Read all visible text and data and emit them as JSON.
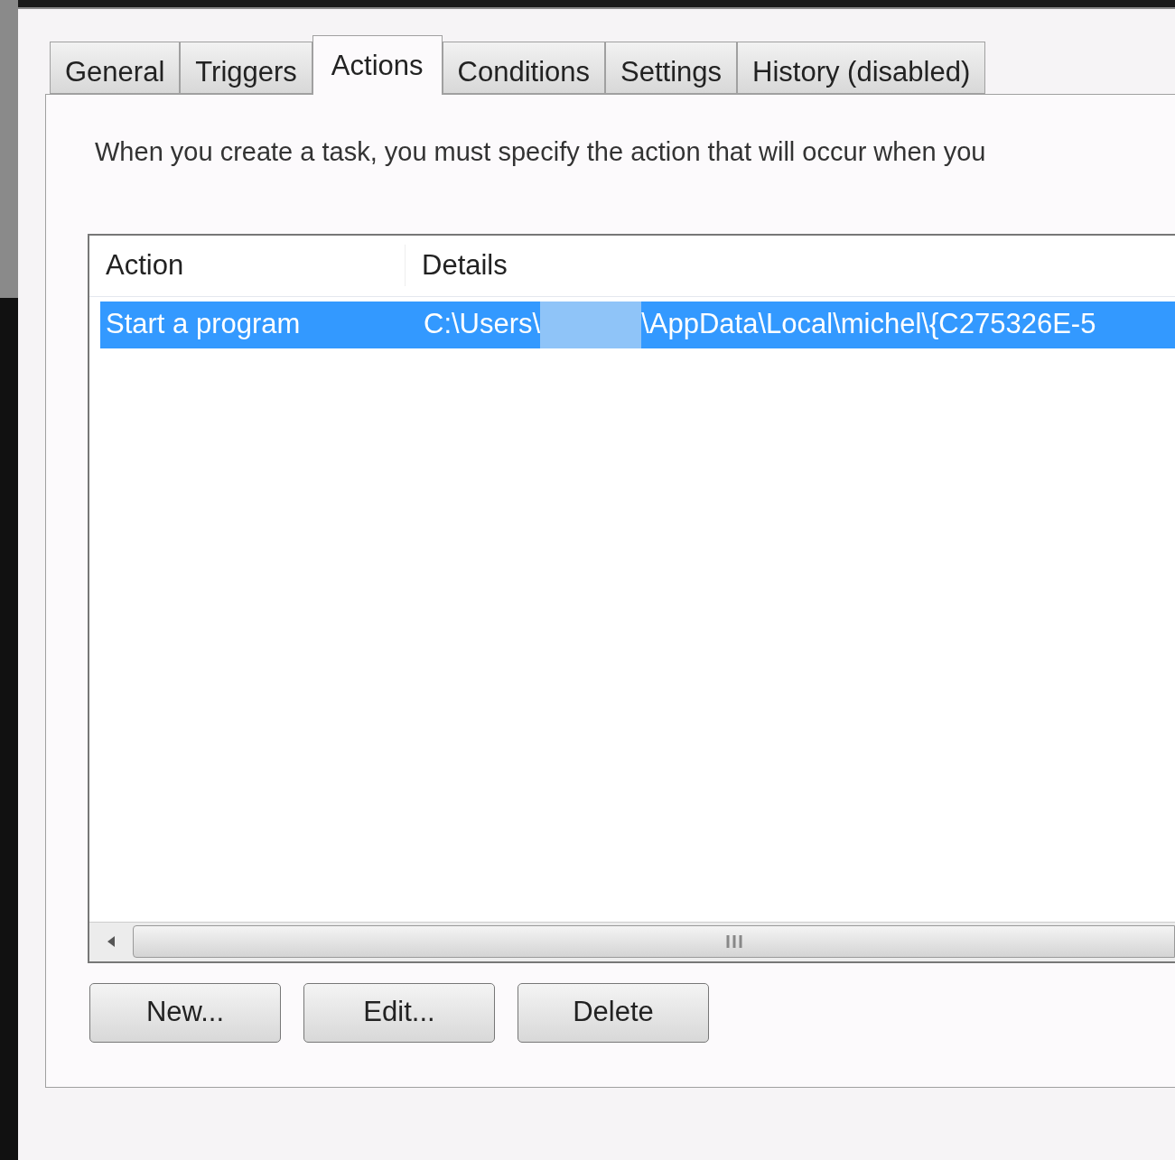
{
  "tabs": [
    {
      "label": "General",
      "selected": false
    },
    {
      "label": "Triggers",
      "selected": false
    },
    {
      "label": "Actions",
      "selected": true
    },
    {
      "label": "Conditions",
      "selected": false
    },
    {
      "label": "Settings",
      "selected": false
    },
    {
      "label": "History (disabled)",
      "selected": false
    }
  ],
  "description": "When you create a task, you must specify the action that will occur when you",
  "table": {
    "columns": [
      "Action",
      "Details"
    ],
    "rows": [
      {
        "action": "Start a program",
        "details_start": "C:\\Users\\",
        "details_end": "\\AppData\\Local\\michel\\{C275326E-5",
        "selected": true
      }
    ]
  },
  "buttons": [
    "New...",
    "Edit...",
    "Delete"
  ]
}
